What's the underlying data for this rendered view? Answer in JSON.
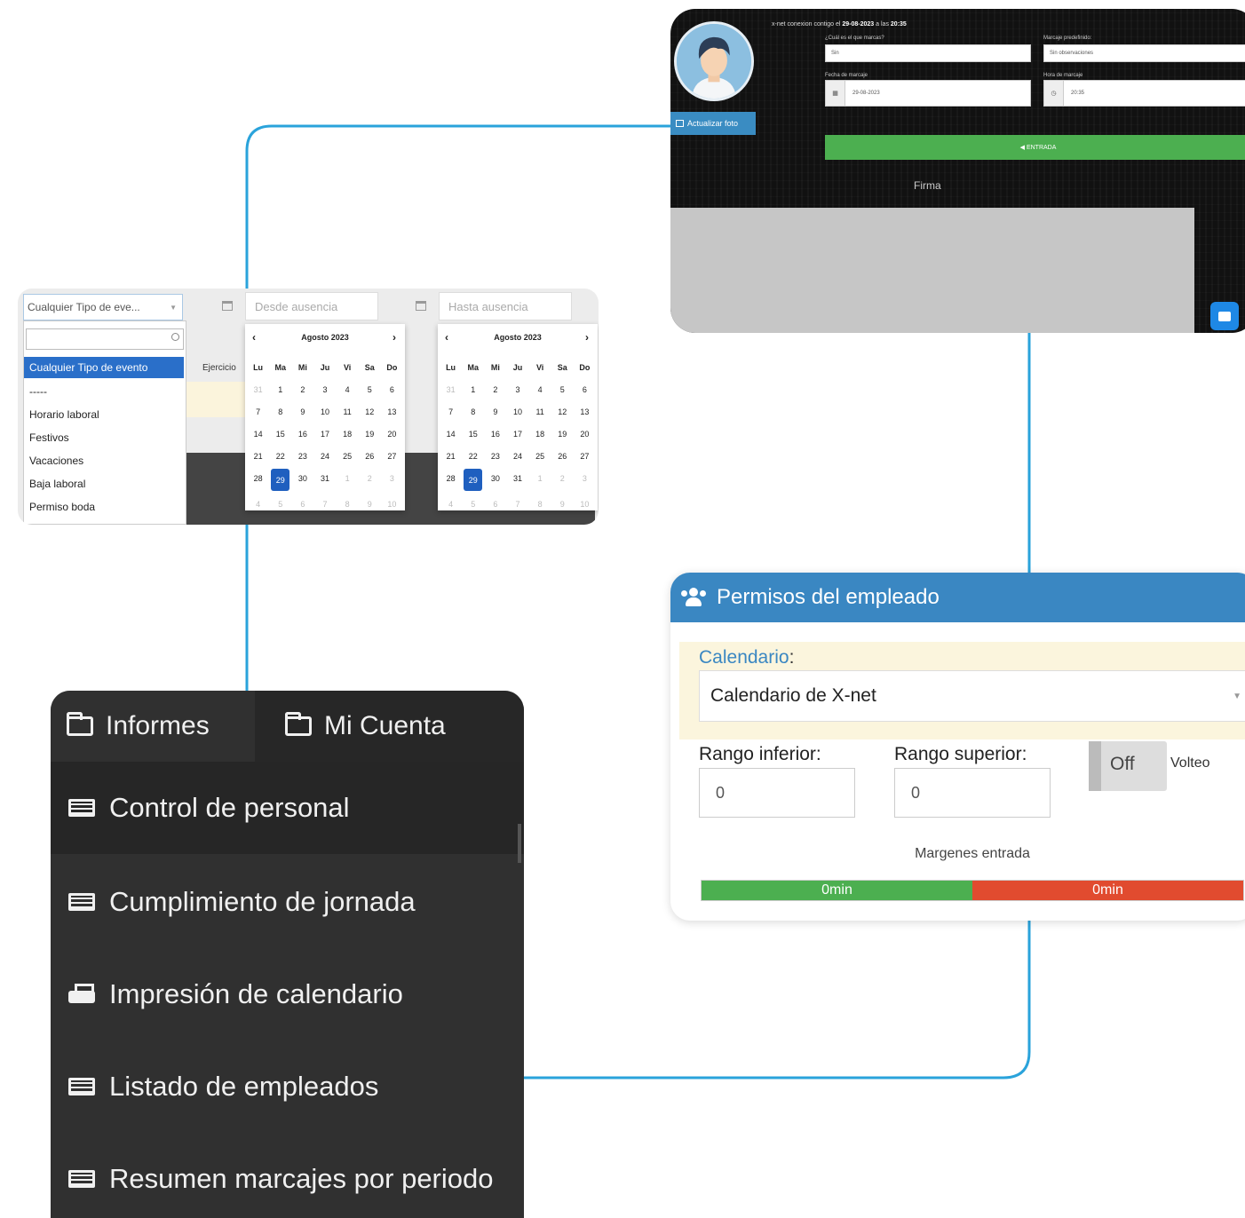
{
  "clock_panel": {
    "message_prefix": "x-net conexion contigo el",
    "message_date": "29-08-2023",
    "message_mid": "a las",
    "message_time": "20:35",
    "which_label": "¿Cuál es el que marcas?",
    "which_value": "Sin",
    "obs_label": "Marcaje predefinido:",
    "obs_value": "Sin observaciones",
    "date_label": "Fecha de marcaje",
    "date_value": "29-08-2023",
    "time_label": "Hora de marcaje",
    "time_value": "20:35",
    "update_photo": "Actualizar foto",
    "entry_button": "◀ ENTRADA",
    "signature_label": "Firma"
  },
  "absence_panel": {
    "type_select_value": "Cualquier Tipo de eve...",
    "type_options": [
      "Cualquier Tipo de evento",
      "-----",
      "Horario laboral",
      "Festivos",
      "Vacaciones",
      "Baja laboral",
      "Permiso boda"
    ],
    "ejercicio_label": "Ejercicio",
    "from_placeholder": "Desde ausencia",
    "to_placeholder": "Hasta ausencia",
    "calendar_month": "Agosto 2023",
    "weekdays": [
      "Lu",
      "Ma",
      "Mi",
      "Ju",
      "Vi",
      "Sa",
      "Do"
    ],
    "days": [
      "31",
      "1",
      "2",
      "3",
      "4",
      "5",
      "6",
      "7",
      "8",
      "9",
      "10",
      "11",
      "12",
      "13",
      "14",
      "15",
      "16",
      "17",
      "18",
      "19",
      "20",
      "21",
      "22",
      "23",
      "24",
      "25",
      "26",
      "27",
      "28",
      "29",
      "30",
      "31",
      "1",
      "2",
      "3",
      "4",
      "5",
      "6",
      "7",
      "8",
      "9",
      "10"
    ],
    "selected_day": "29"
  },
  "menu_panel": {
    "tabs": [
      {
        "label": "Informes"
      },
      {
        "label": "Mi Cuenta"
      }
    ],
    "items": [
      {
        "label": "Control de personal",
        "icon": "list-icon"
      },
      {
        "label": "Cumplimiento de jornada",
        "icon": "list-icon"
      },
      {
        "label": "Impresión de calendario",
        "icon": "print-icon"
      },
      {
        "label": "Listado de empleados",
        "icon": "list-icon"
      },
      {
        "label": "Resumen marcajes por periodo",
        "icon": "list-icon"
      }
    ]
  },
  "permissions_panel": {
    "title": "Permisos del empleado",
    "calendar_label": "Calendario",
    "calendar_value": "Calendario de X-net",
    "lower_range_label": "Rango inferior:",
    "lower_range_value": "0",
    "upper_range_label": "Rango superior:",
    "upper_range_value": "0",
    "toggle_label": "Off",
    "volteo_label": "Volteo",
    "margins_title": "Margenes entrada",
    "margin_green": "0min",
    "margin_red": "0min"
  },
  "colors": {
    "connector": "#2aa3db",
    "header_blue": "#3a87c2",
    "green": "#4caf50",
    "red": "#e14b2f",
    "menu_bg": "#303030"
  }
}
